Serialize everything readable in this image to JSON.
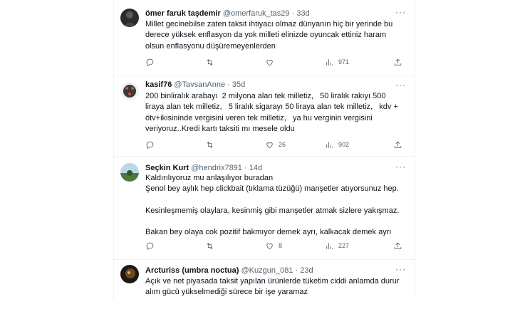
{
  "tweets": [
    {
      "name": "ömer faruk taşdemir",
      "handle": "@omerfaruk_tas29",
      "dot": "·",
      "date": "33d",
      "text": "Millet gecinebilse zaten taksit ihtiyacı olmaz dünyanın hiç bir yerinde bu derece yüksek enflasyon da yok milleti elinizde oyuncak ettiniz haram olsun enflasyonu düşüremeyenlerden",
      "replies": "",
      "retweets": "",
      "likes": "",
      "views": "971"
    },
    {
      "name": "kasif76",
      "handle": "@TavsanAnne",
      "dot": "·",
      "date": "35d",
      "text": "200 binliralık arabayı  2 milyona alan tek milletiz,   50 liralık rakıyı 500 liraya alan tek milletiz,   5 liralık sigarayı 50 liraya alan tek milletiz,   kdv + ötv+ikisininde vergisini veren tek milletiz,   ya hu verginin vergisini veriyoruz..Kredi kartı taksiti mı mesele oldu",
      "replies": "",
      "retweets": "",
      "likes": "26",
      "views": "902"
    },
    {
      "name": "Seçkin Kurt",
      "handle": "@hendrix7891",
      "dot": "·",
      "date": "14d",
      "paragraphs": [
        "Kaldırılıyoruz mu anlaşılıyor buradan",
        "Şenol bey aylık hep clickbait (tıklama tüzüğü) manşetler atıyorsunuz hep.",
        "Kesinleşmemiş olaylara, kesinmiş gibi manşetler atmak sizlere yakışmaz.",
        "Bakan bey olaya cok pozitif bakmıyor demek ayrı, kalkacak demek ayrı"
      ],
      "replies": "",
      "retweets": "",
      "likes": "8",
      "views": "227"
    },
    {
      "name": "Arcturiss (umbra noctua)",
      "handle": "@Kuzgun_081",
      "dot": "·",
      "date": "23d",
      "text": "Açık ve net piyasada taksit yapılan ürünlerde tüketim ciddi anlamda durur alım gücü yükselmediği sürece bir işe yaramaz"
    }
  ],
  "icons": {
    "reply": "reply-icon",
    "retweet": "retweet-icon",
    "like": "heart-icon",
    "views": "views-chart-icon",
    "share": "share-icon",
    "more": "more-dots-icon"
  }
}
